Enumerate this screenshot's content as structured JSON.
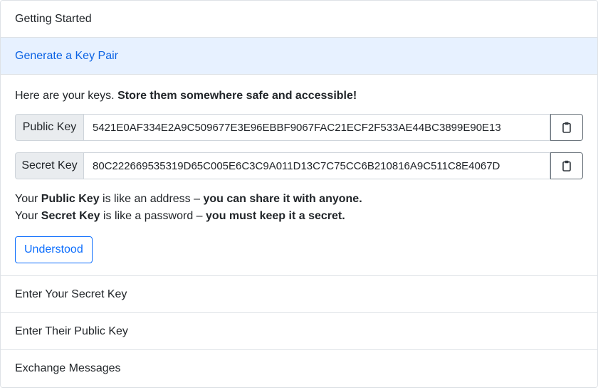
{
  "sections": {
    "getting_started": "Getting Started",
    "generate_key_pair": "Generate a Key Pair",
    "enter_secret_key": "Enter Your Secret Key",
    "enter_public_key": "Enter Their Public Key",
    "exchange_messages": "Exchange Messages"
  },
  "keypair": {
    "intro_prefix": "Here are your keys.",
    "intro_bold": "Store them somewhere safe and accessible!",
    "public_label": "Public Key",
    "public_value": "5421E0AF334E2A9C509677E3E96EBBF9067FAC21ECF2F533AE44BC3899E90E13",
    "secret_label": "Secret Key",
    "secret_value": "80C222669535319D65C005E6C3C9A011D13C7C75CC6B210816A9C511C8E4067D",
    "copy_icon": "clipboard-icon",
    "note1": {
      "prefix": "Your",
      "key": "Public Key",
      "middle": "is like an address –",
      "bold": "you can share it with anyone."
    },
    "note2": {
      "prefix": "Your",
      "key": "Secret Key",
      "middle": "is like a password –",
      "bold": "you must keep it a secret."
    },
    "understood_label": "Understood"
  },
  "colors": {
    "accent": "#0d6efd",
    "active_header_bg": "#e7f1ff",
    "active_header_text": "#0c63e4"
  }
}
